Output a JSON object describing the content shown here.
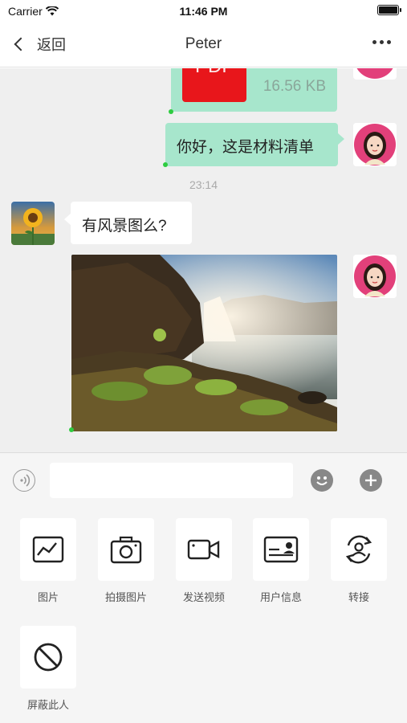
{
  "status_bar": {
    "carrier": "Carrier",
    "time": "11:46 PM"
  },
  "nav": {
    "back_label": "返回",
    "title": "Peter"
  },
  "messages": {
    "file_size": "16.56 KB",
    "file_type": "PDF",
    "text_message": "你好，这是材料清单",
    "timestamp": "23:14",
    "question": "有风景图么?"
  },
  "input": {
    "placeholder": ""
  },
  "panel": {
    "items": [
      {
        "label": "图片",
        "icon": "image-icon"
      },
      {
        "label": "拍摄图片",
        "icon": "camera-icon"
      },
      {
        "label": "发送视频",
        "icon": "video-icon"
      },
      {
        "label": "用户信息",
        "icon": "user-card-icon"
      },
      {
        "label": "转接",
        "icon": "transfer-icon"
      },
      {
        "label": "屏蔽此人",
        "icon": "block-icon"
      }
    ]
  },
  "colors": {
    "bubble_green": "#a7e6cc",
    "chat_bg": "#efefef",
    "panel_bg": "#f5f5f5",
    "pdf_red": "#e8161b"
  }
}
